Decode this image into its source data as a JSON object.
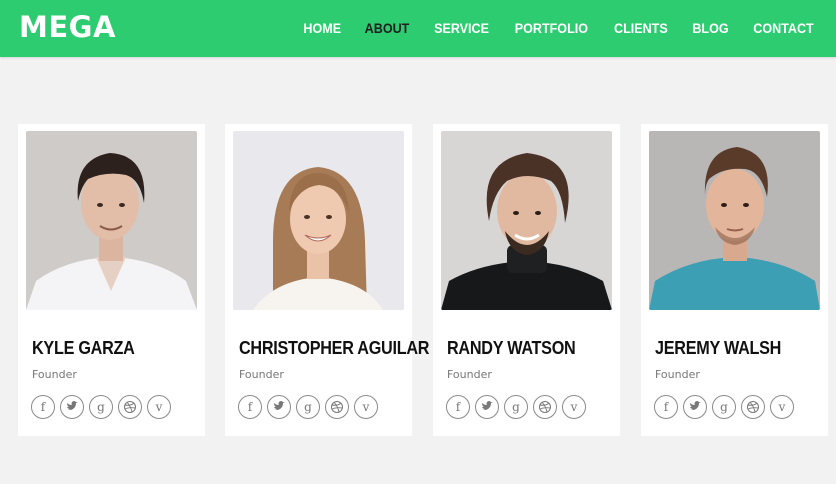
{
  "brand": {
    "logo": "MEGA",
    "accent": "#2ecc71"
  },
  "nav": {
    "items": [
      {
        "label": "HOME",
        "active": false
      },
      {
        "label": "ABOUT",
        "active": true
      },
      {
        "label": "SERVICE",
        "active": false
      },
      {
        "label": "PORTFOLIO",
        "active": false
      },
      {
        "label": "CLIENTS",
        "active": false
      },
      {
        "label": "BLOG",
        "active": false
      },
      {
        "label": "CONTACT",
        "active": false
      }
    ]
  },
  "team": [
    {
      "name": "KYLE GARZA",
      "role": "Founder",
      "photo": "man-white-shirt"
    },
    {
      "name": "CHRISTOPHER AGUILAR",
      "role": "Founder",
      "photo": "woman-long-hair"
    },
    {
      "name": "RANDY WATSON",
      "role": "Founder",
      "photo": "man-black-turtleneck"
    },
    {
      "name": "JEREMY WALSH",
      "role": "Founder",
      "photo": "man-teal-shirt"
    }
  ],
  "social_icons": [
    "facebook-icon",
    "twitter-icon",
    "google-plus-icon",
    "dribbble-icon",
    "vimeo-icon"
  ]
}
